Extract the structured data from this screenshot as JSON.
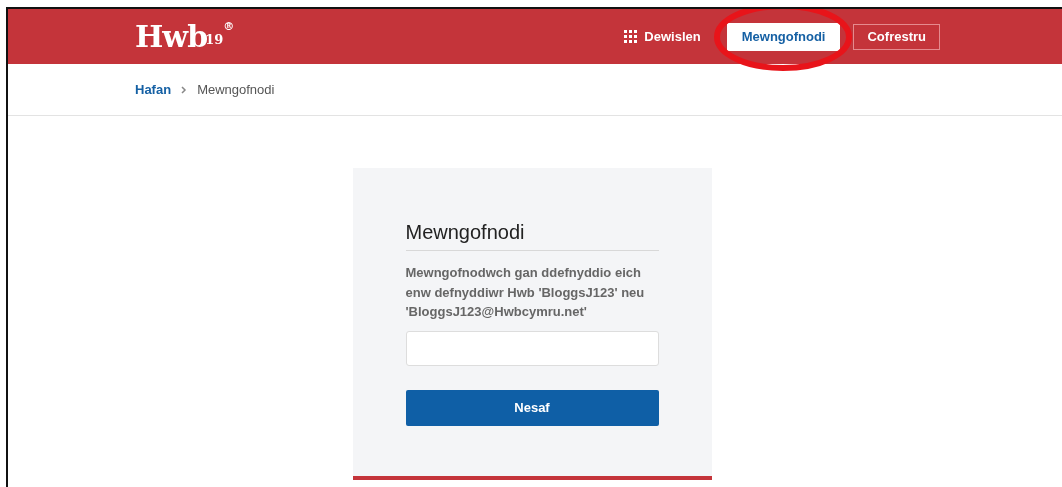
{
  "header": {
    "logo": {
      "name": "Hwb",
      "number": "19",
      "mark": "®"
    },
    "nav": [
      {
        "kind": "menu",
        "label": "Dewislen",
        "selected": false,
        "highlighted": false
      },
      {
        "kind": "filled",
        "label": "Mewngofnodi",
        "selected": true,
        "highlighted": true
      },
      {
        "kind": "outline",
        "label": "Cofrestru",
        "selected": false,
        "highlighted": false
      }
    ]
  },
  "breadcrumb": [
    {
      "label": "Hafan",
      "link": true
    },
    {
      "label": "Mewngofnodi",
      "link": false
    }
  ],
  "login": {
    "title": "Mewngofnodi",
    "description": "Mewngofnodwch gan ddefnyddio eich enw defnyddiwr Hwb 'BloggsJ123' neu 'BloggsJ123@Hwbcymru.net'",
    "button": "Nesaf"
  }
}
